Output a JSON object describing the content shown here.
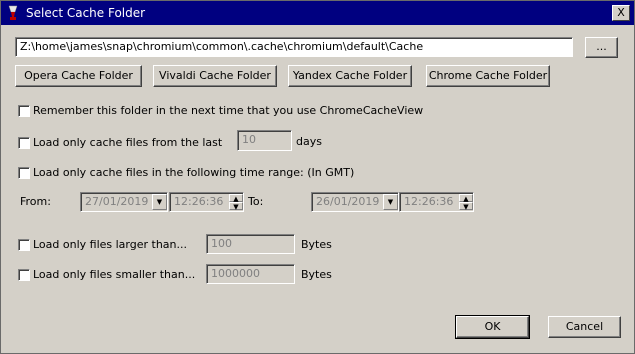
{
  "window": {
    "title": "Select Cache Folder",
    "close_glyph": "X"
  },
  "folder": {
    "path": "Z:\\home\\james\\snap\\chromium\\common\\.cache\\chromium\\default\\Cache",
    "browse_label": "..."
  },
  "presets": [
    "Opera Cache Folder",
    "Vivaldi Cache Folder",
    "Yandex Cache Folder",
    "Chrome Cache Folder"
  ],
  "options": {
    "remember_label": "Remember this folder in the next time that you use ChromeCacheView",
    "last_label": "Load only cache files from the last",
    "last_value": "10",
    "last_unit": "days",
    "range_label": "Load only cache files in the following time range: (In GMT)",
    "from_label": "From:",
    "from_date": "27/01/2019",
    "from_time": "12:26:36",
    "to_label": "To:",
    "to_date": "26/01/2019",
    "to_time": "12:26:36",
    "larger_label": "Load only files larger than...",
    "larger_value": "100",
    "larger_unit": "Bytes",
    "smaller_label": "Load only files smaller than...",
    "smaller_value": "1000000",
    "smaller_unit": "Bytes"
  },
  "footer": {
    "ok_label": "OK",
    "cancel_label": "Cancel"
  }
}
